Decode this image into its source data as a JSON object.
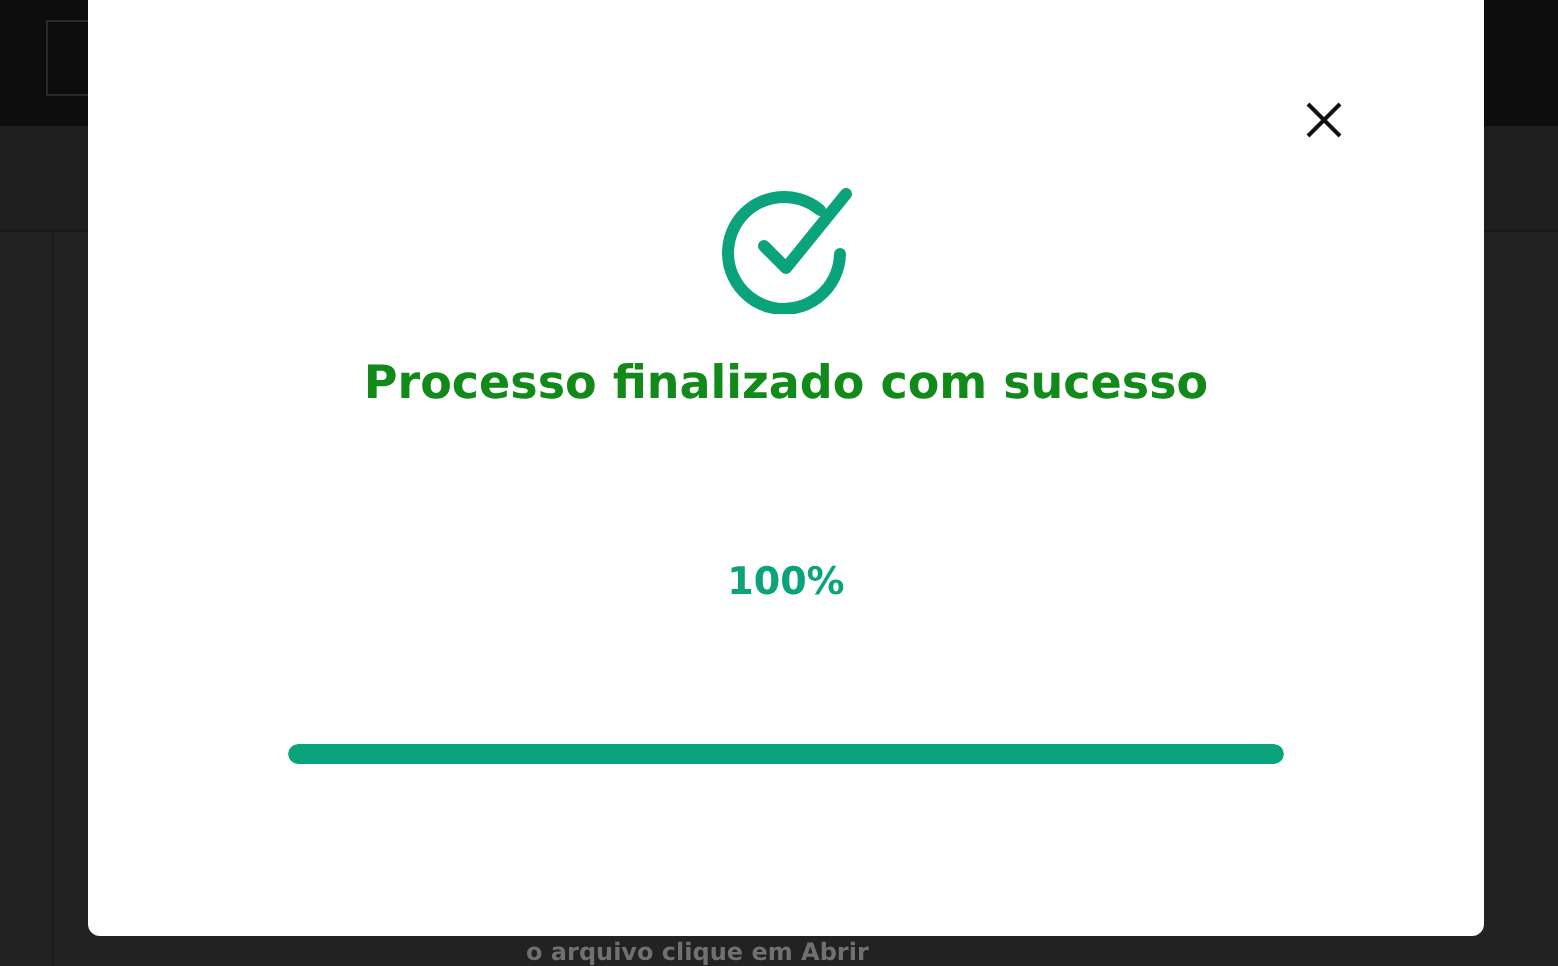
{
  "background": {
    "text": "o arquivo clique em Abrir"
  },
  "dialog": {
    "title": "Processo finalizado com sucesso",
    "percent": "100%",
    "progress": {
      "level": 1
    }
  }
}
